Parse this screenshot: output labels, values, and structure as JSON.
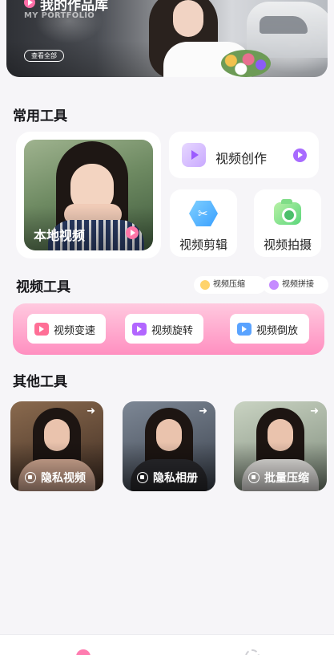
{
  "portfolio": {
    "title": "我的作品库",
    "subtitle": "MY PORTFOLIO",
    "view_all_label": "查看全部"
  },
  "common_tools": {
    "section_title": "常用工具",
    "local_video_label": "本地视频",
    "video_create_label": "视频创作",
    "video_edit_label": "视频剪辑",
    "video_shoot_label": "视频拍摄"
  },
  "video_tools": {
    "section_title": "视频工具",
    "compress_chip_label": "视频压缩",
    "splice_chip_label": "视频拼接",
    "speed_label": "视频变速",
    "rotate_label": "视频旋转",
    "reverse_label": "视频倒放"
  },
  "other_tools": {
    "section_title": "其他工具",
    "private_video_label": "隐私视频",
    "private_album_label": "隐私相册",
    "batch_compress_label": "批量压缩"
  },
  "colors": {
    "accent_pink": "#ff76a7",
    "accent_purple": "#a86bff",
    "background": "#f6f5f8"
  }
}
